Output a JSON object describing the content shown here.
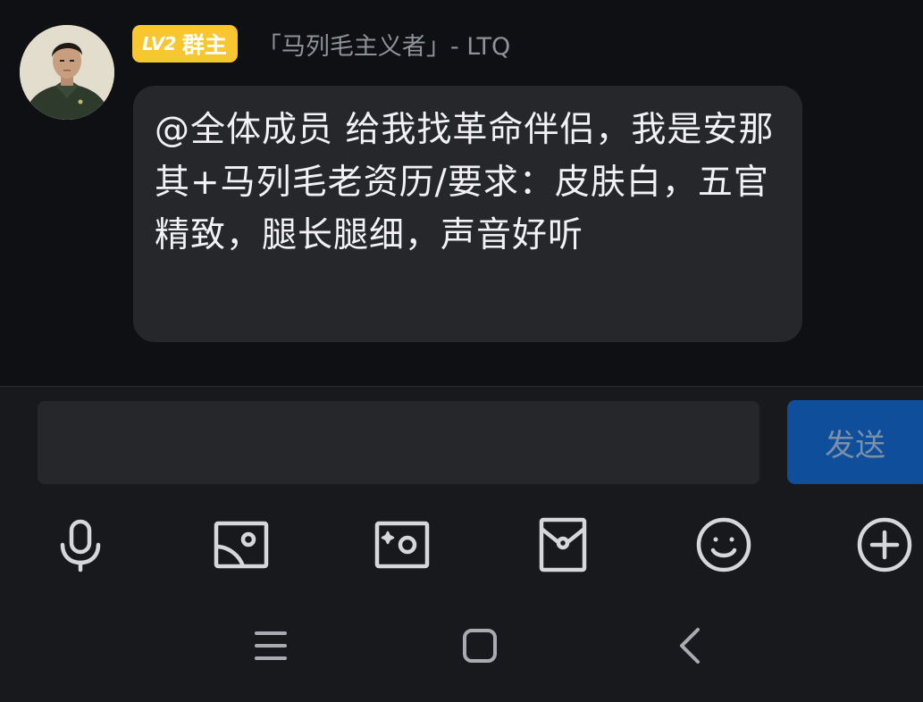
{
  "message": {
    "sender": {
      "badge_level": "LV2",
      "badge_role": "群主",
      "name": "「马列毛主义者」- LTQ"
    },
    "text": "@全体成员 给我找革命伴侣，我是安那其+马列毛老资历/要求：皮肤白，五官精致，腿长腿细，声音好听"
  },
  "composer": {
    "input_value": "",
    "send_label": "发送"
  },
  "toolbar": {
    "icons": [
      "microphone-icon",
      "image-icon",
      "camera-icon",
      "red-packet-icon",
      "emoji-icon",
      "plus-icon"
    ]
  },
  "system_nav": {
    "icons": [
      "recent-apps-icon",
      "home-icon",
      "back-icon"
    ]
  },
  "colors": {
    "background": "#0f1013",
    "bubble": "#26272b",
    "badge": "#f8c62e",
    "send_button": "#0f4e9a",
    "icon": "#d6d7db"
  }
}
